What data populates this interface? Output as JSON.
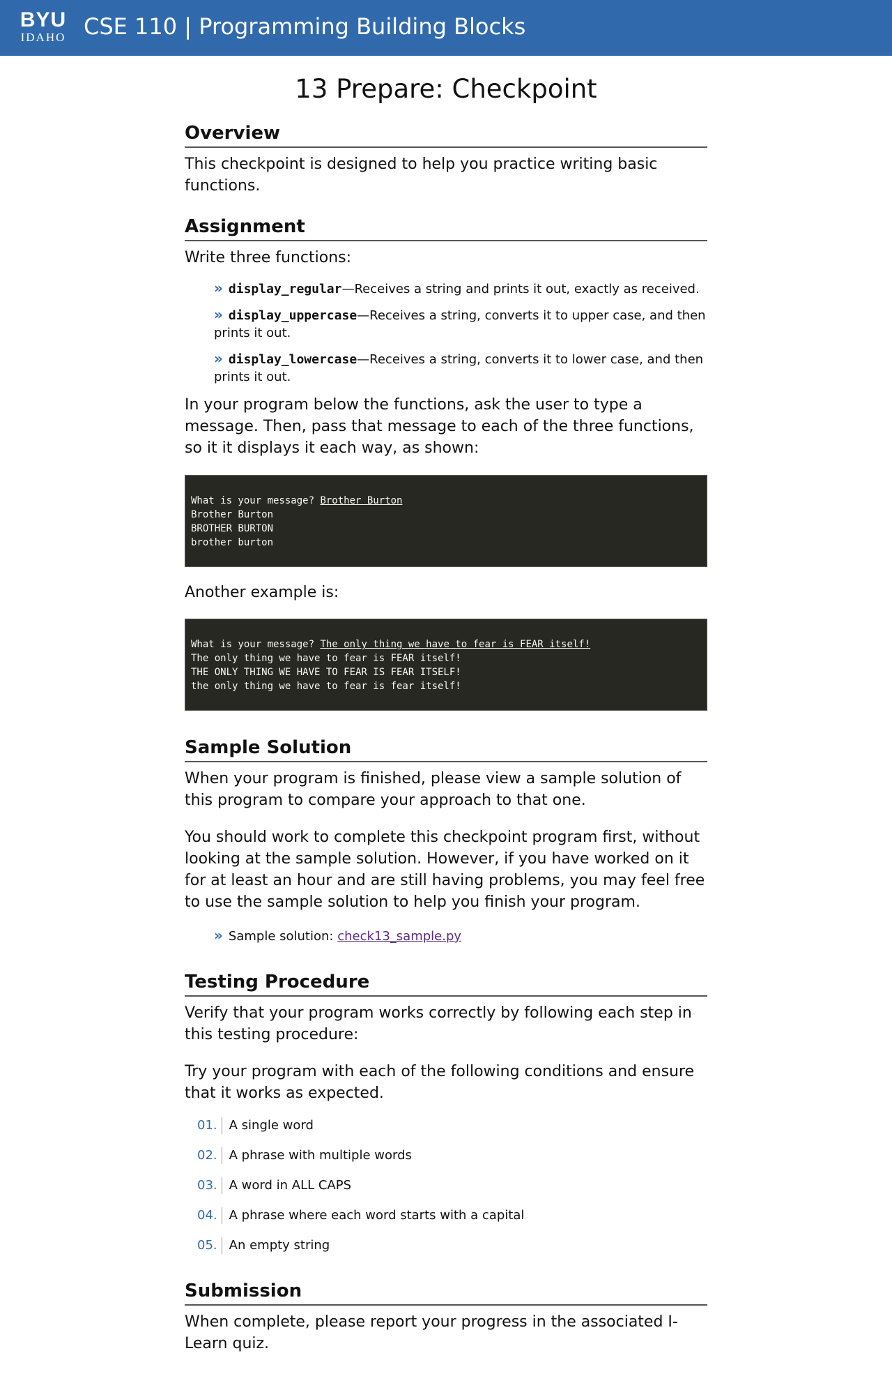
{
  "header": {
    "logo_top": "BYU",
    "logo_bottom": "IDAHO",
    "course_title": "CSE 110 | Programming Building Blocks"
  },
  "page_title": "13 Prepare: Checkpoint",
  "overview": {
    "heading": "Overview",
    "text": "This checkpoint is designed to help you practice writing basic functions."
  },
  "assignment": {
    "heading": "Assignment",
    "intro": "Write three functions:",
    "functions": [
      {
        "name": "display_regular",
        "desc": "—Receives a string and prints it out, exactly as received."
      },
      {
        "name": "display_uppercase",
        "desc": "—Receives a string, converts it to upper case, and then prints it out."
      },
      {
        "name": "display_lowercase",
        "desc": "—Receives a string, converts it to lower case, and then prints it out."
      }
    ],
    "program_text": "In your program below the functions, ask the user to type a message. Then, pass that message to each of the three functions, so it it displays it each way, as shown:",
    "example1": {
      "prompt": "What is your message? ",
      "input": "Brother Burton",
      "lines": [
        "Brother Burton",
        "BROTHER BURTON",
        "brother burton"
      ]
    },
    "another_example": "Another example is:",
    "example2": {
      "prompt": "What is your message? ",
      "input": "The only thing we have to fear is FEAR itself!",
      "lines": [
        "The only thing we have to fear is FEAR itself!",
        "THE ONLY THING WE HAVE TO FEAR IS FEAR ITSELF!",
        "the only thing we have to fear is fear itself!"
      ]
    }
  },
  "sample_solution": {
    "heading": "Sample Solution",
    "p1": "When your program is finished, please view a sample solution of this program to compare your approach to that one.",
    "p2": "You should work to complete this checkpoint program first, without looking at the sample solution. However, if you have worked on it for at least an hour and are still having problems, you may feel free to use the sample solution to help you finish your program.",
    "link_label": "Sample solution: ",
    "link_text": "check13_sample.py"
  },
  "testing": {
    "heading": "Testing Procedure",
    "p1": "Verify that your program works correctly by following each step in this testing procedure:",
    "p2": "Try your program with each of the following conditions and ensure that it works as expected.",
    "steps": [
      {
        "num": "01.",
        "text": "A single word"
      },
      {
        "num": "02.",
        "text": "A phrase with multiple words"
      },
      {
        "num": "03.",
        "text": "A word in ALL CAPS"
      },
      {
        "num": "04.",
        "text": "A phrase where each word starts with a capital"
      },
      {
        "num": "05.",
        "text": "An empty string"
      }
    ]
  },
  "submission": {
    "heading": "Submission",
    "text": "When complete, please report your progress in the associated I-Learn quiz."
  },
  "colors": {
    "header_bg": "#306aad",
    "terminal_bg": "#272822",
    "accent": "#306aad",
    "link": "#5a2a83"
  }
}
